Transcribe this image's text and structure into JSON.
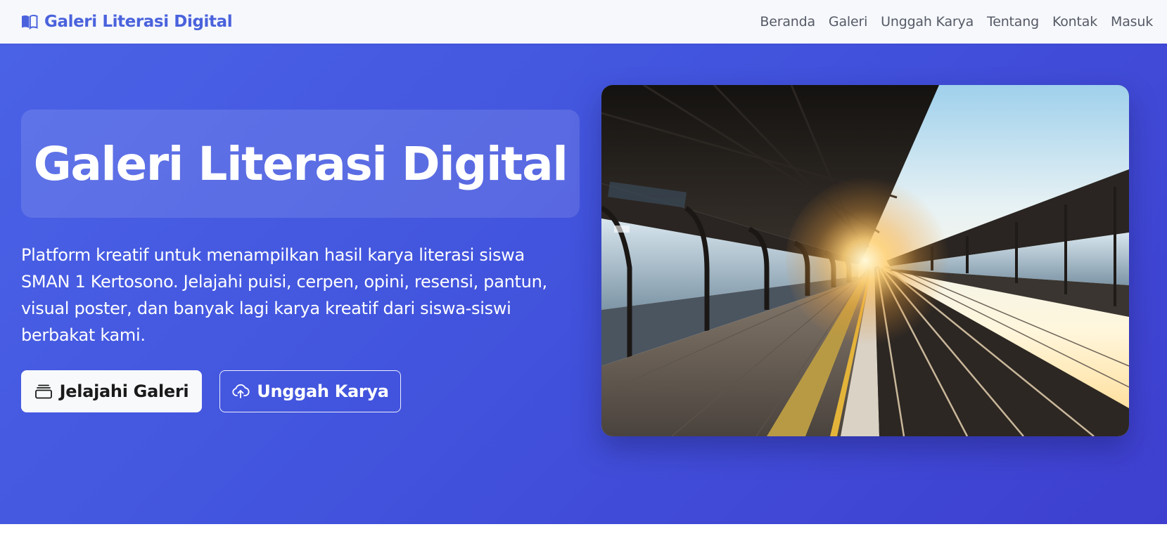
{
  "navbar": {
    "brand_icon": "open-book-icon",
    "brand": "Galeri Literasi Digital",
    "links": [
      "Beranda",
      "Galeri",
      "Unggah Karya",
      "Tentang",
      "Kontak",
      "Masuk"
    ]
  },
  "hero": {
    "title": "Galeri Literasi Digital",
    "description": "Platform kreatif untuk menampilkan hasil karya literasi siswa SMAN 1 Kertosono. Jelajahi puisi, cerpen, opini, resensi, pantun, visual poster, dan banyak lagi karya kreatif dari siswa-siswi berbakat kami.",
    "primary_button": {
      "icon": "collection-icon",
      "label": "Jelajahi Galeri"
    },
    "secondary_button": {
      "icon": "cloud-upload-icon",
      "label": "Unggah Karya"
    },
    "image": "train-station-platform-photo"
  },
  "colors": {
    "brand": "#4a62dc",
    "hero_gradient_start": "#4a62e6",
    "hero_gradient_end": "#3e3fcf",
    "nav_background": "#f6f8fc"
  }
}
